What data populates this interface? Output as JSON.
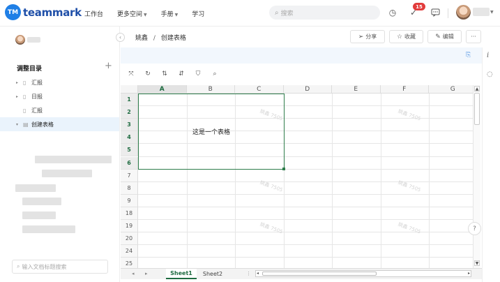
{
  "app": {
    "logo_badge": "TM",
    "logo_text": "teammark"
  },
  "nav": {
    "items": [
      {
        "label": "工作台",
        "has_caret": false
      },
      {
        "label": "更多空间",
        "has_caret": true
      },
      {
        "label": "手册",
        "has_caret": true
      },
      {
        "label": "学习",
        "has_caret": false
      }
    ]
  },
  "search": {
    "placeholder": "搜索"
  },
  "notifications": {
    "count": "15"
  },
  "sidebar": {
    "title": "调整目录",
    "add_label": "+",
    "items": [
      {
        "label": "汇报",
        "has_arrow": true,
        "icon": "doc-icon",
        "active": false
      },
      {
        "label": "日报",
        "has_arrow": true,
        "icon": "doc-icon",
        "active": false
      },
      {
        "label": "汇报",
        "has_arrow": false,
        "icon": "doc-icon",
        "active": false
      },
      {
        "label": "创建表格",
        "has_arrow": true,
        "icon": "sheet-icon",
        "active": true
      }
    ],
    "search_placeholder": "输入文档标题搜索"
  },
  "header": {
    "breadcrumb_parent": "姚鑫",
    "breadcrumb_separator": "/",
    "breadcrumb_current": "创建表格",
    "share_label": "分享",
    "favorite_label": "收藏",
    "edit_label": "编辑",
    "more_label": "···"
  },
  "sheet": {
    "columns": [
      "A",
      "B",
      "C",
      "D",
      "E",
      "F",
      "G"
    ],
    "selected_column": "A",
    "rows": [
      "1",
      "2",
      "3",
      "4",
      "5",
      "6",
      "7",
      "8",
      "9",
      "18",
      "19",
      "20",
      "24",
      "25"
    ],
    "selected_rows": [
      "1",
      "2",
      "3",
      "4",
      "5",
      "6"
    ],
    "merged_cell_text": "这是一个表格",
    "watermark_text": "姚鑫 7505",
    "tabs": [
      {
        "label": "Sheet1",
        "active": true
      },
      {
        "label": "Sheet2",
        "active": false
      }
    ]
  },
  "colors": {
    "brand": "#1f7fe6",
    "selection": "#2e7d4b",
    "badge": "#e23b3b",
    "strip": "#f2f7fd"
  }
}
